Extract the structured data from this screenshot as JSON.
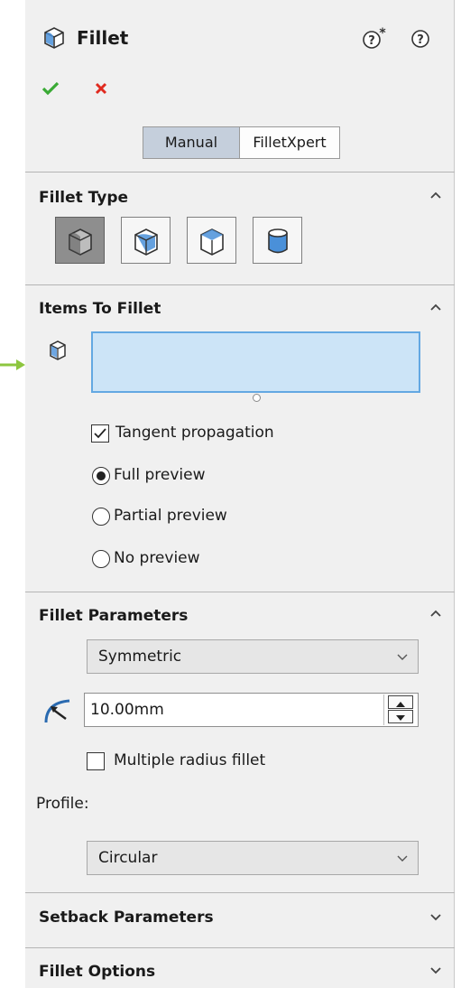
{
  "header": {
    "title": "Fillet",
    "confirm_icon": "checkmark-icon",
    "cancel_icon": "x-icon",
    "help_icons": [
      "help-star-icon",
      "help-icon"
    ]
  },
  "mode_tabs": {
    "manual": "Manual",
    "filletxpert": "FilletXpert",
    "selected": "Manual"
  },
  "sections": {
    "fillet_type": {
      "title": "Fillet Type",
      "expanded": true
    },
    "items_to_fillet": {
      "title": "Items To Fillet",
      "expanded": true
    },
    "fillet_parameters": {
      "title": "Fillet Parameters",
      "expanded": true
    },
    "setback_parameters": {
      "title": "Setback Parameters",
      "expanded": false
    },
    "fillet_options": {
      "title": "Fillet Options",
      "expanded": false
    }
  },
  "fillet_type_options": [
    "constant-size-fillet-icon",
    "variable-size-fillet-icon",
    "face-fillet-icon",
    "full-round-fillet-icon"
  ],
  "items": {
    "tangent_propagation": {
      "label": "Tangent propagation",
      "checked": true
    },
    "preview_options": [
      {
        "label": "Full preview",
        "selected": true
      },
      {
        "label": "Partial preview",
        "selected": false
      },
      {
        "label": "No preview",
        "selected": false
      }
    ]
  },
  "parameters": {
    "method": "Symmetric",
    "radius": "10.00mm",
    "multiple_radius": {
      "label": "Multiple radius fillet",
      "checked": false
    },
    "profile_label": "Profile:",
    "profile": "Circular"
  },
  "colors": {
    "confirm": "#3aaa35",
    "cancel": "#e02a1f",
    "selection_box": "#cce4f7",
    "selection_border": "#63a8e2",
    "pointer_arrow": "#8dc63f"
  }
}
